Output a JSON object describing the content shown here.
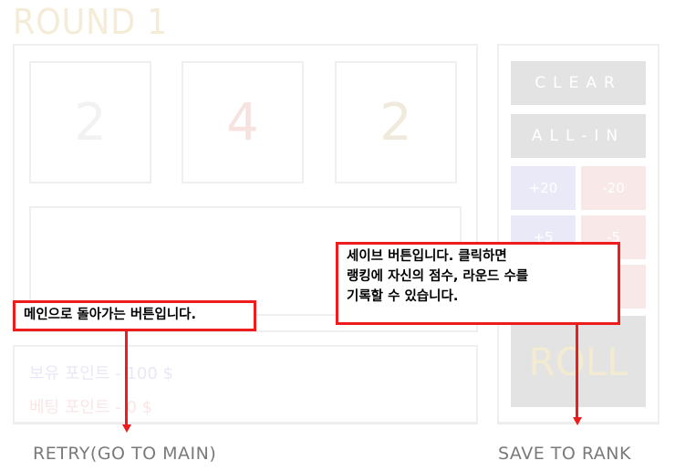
{
  "header": {
    "round_title": "ROUND 1"
  },
  "dice": [
    {
      "value": "2",
      "color": "#f2f2f2"
    },
    {
      "value": "4",
      "color": "#f6e3e0"
    },
    {
      "value": "2",
      "color": "#efeadb"
    }
  ],
  "points": {
    "holding": "보유 포인트 - 100 $",
    "betting": "베팅 포인트 - 0 $"
  },
  "controls": {
    "clear": "CLEAR",
    "all_in": "ALL-IN",
    "plus20": "+20",
    "minus20": "-20",
    "plus5": "+5",
    "minus5": "-5",
    "plus1": "",
    "minus1": "",
    "roll": "ROLL"
  },
  "bottom": {
    "retry": "RETRY(GO TO MAIN)",
    "save_rank": "SAVE TO RANK"
  },
  "annotations": {
    "retry_note": "메인으로 돌아가는 버튼입니다.",
    "save_note_line1": "세이브 버튼입니다. 클릭하면",
    "save_note_line2": "랭킹에 자신의 점수, 라운드 수를",
    "save_note_line3": "기록할 수 있습니다.",
    "callout_color": "#ee1c1c"
  },
  "colors": {
    "panel_border": "#efefef",
    "button_gray": "#e3e3e3",
    "plus_blue": "#e9e9f7",
    "minus_red": "#f8e8e8",
    "title_cream": "#f4ecd6"
  }
}
